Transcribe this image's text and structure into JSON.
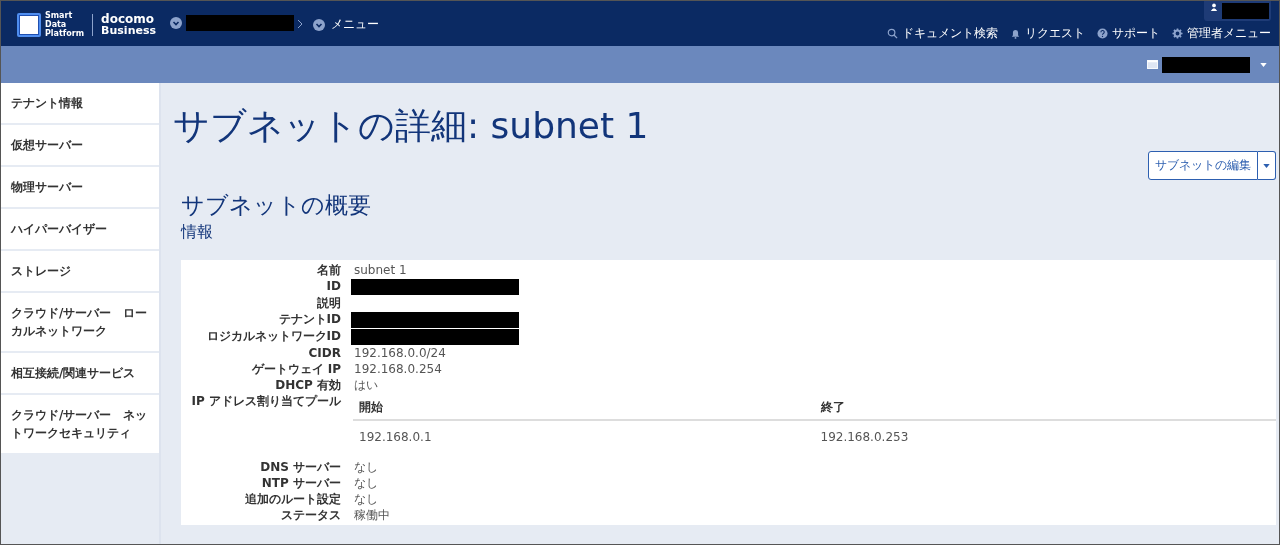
{
  "header": {
    "logo": {
      "product_lines": [
        "Smart",
        "Data",
        "Platform"
      ],
      "brand_top": "docomo",
      "brand_bottom": "Business"
    },
    "menu_label": "メニュー",
    "utility_links": [
      {
        "label": "ドキュメント検索",
        "kind": "search"
      },
      {
        "label": "リクエスト",
        "kind": "bell"
      },
      {
        "label": "サポート",
        "kind": "help"
      },
      {
        "label": "管理者メニュー",
        "kind": "gear"
      }
    ]
  },
  "sidebar": {
    "items": [
      {
        "label": "テナント情報"
      },
      {
        "label": "仮想サーバー"
      },
      {
        "label": "物理サーバー"
      },
      {
        "label": "ハイパーバイザー"
      },
      {
        "label": "ストレージ"
      },
      {
        "label": "クラウド/サーバー　ローカルネットワーク"
      },
      {
        "label": "相互接続/関連サービス"
      },
      {
        "label": "クラウド/サーバー　ネットワークセキュリティ"
      }
    ]
  },
  "page": {
    "title": "サブネットの詳細: subnet 1",
    "edit_button": "サブネットの編集",
    "section_title": "サブネットの概要",
    "subsection_title": "情報"
  },
  "details": [
    {
      "label": "名前",
      "kind": "text",
      "value": "subnet 1"
    },
    {
      "label": "ID",
      "kind": "redacted"
    },
    {
      "label": "説明",
      "kind": "empty"
    },
    {
      "label": "テナントID",
      "kind": "redacted"
    },
    {
      "label": "ロジカルネットワークID",
      "kind": "redacted"
    },
    {
      "label": "CIDR",
      "kind": "text",
      "value": "192.168.0.0/24"
    },
    {
      "label": "ゲートウェイ IP",
      "kind": "text",
      "value": "192.168.0.254"
    },
    {
      "label": "DHCP 有効",
      "kind": "text",
      "value": "はい"
    },
    {
      "label": "IP アドレス割り当てプール",
      "kind": "pool",
      "columns": [
        "開始",
        "終了"
      ],
      "rows": [
        [
          "192.168.0.1",
          "192.168.0.253"
        ]
      ]
    },
    {
      "label": "DNS サーバー",
      "kind": "text",
      "value": "なし"
    },
    {
      "label": "NTP サーバー",
      "kind": "text",
      "value": "なし"
    },
    {
      "label": "追加のルート設定",
      "kind": "text",
      "value": "なし"
    },
    {
      "label": "ステータス",
      "kind": "text",
      "value": "稼働中"
    }
  ]
}
